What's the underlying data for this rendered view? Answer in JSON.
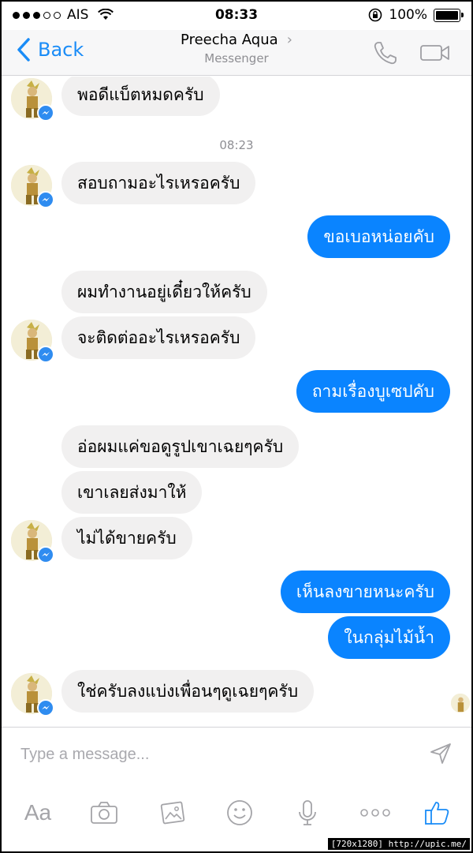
{
  "status_bar": {
    "carrier": "AIS",
    "time": "08:33",
    "battery": "100%",
    "signal_bars_filled": 3,
    "signal_bars_total": 5
  },
  "nav": {
    "back_label": "Back",
    "contact_name": "Preecha Aqua",
    "contact_subtitle": "Messenger"
  },
  "conversation": {
    "timestamp": "08:23",
    "messages": [
      {
        "side": "in",
        "text": "พอดีแบ็ตหมดครับ"
      },
      {
        "side": "in",
        "text": "สอบถามอะไรเหรอครับ"
      },
      {
        "side": "out",
        "text": "ขอเบอหน่อยคับ"
      },
      {
        "side": "in",
        "text": "ผมทำงานอยู่เดี๋ยวให้ครับ"
      },
      {
        "side": "in",
        "text": "จะติดต่ออะไรเหรอครับ"
      },
      {
        "side": "out",
        "text": "ถามเรื่องบูเซปคับ"
      },
      {
        "side": "in",
        "text": "อ่อผมแค่ขอดูรูปเขาเฉยๆครับ"
      },
      {
        "side": "in",
        "text": "เขาเลยส่งมาให้"
      },
      {
        "side": "in",
        "text": "ไม่ได้ขายครับ"
      },
      {
        "side": "out",
        "text": "เห็นลงขายหนะครับ"
      },
      {
        "side": "out",
        "text": "ในกลุ่มไม้น้ำ"
      },
      {
        "side": "in",
        "text": "ใช่ครับลงแบ่งเพื่อนๆดูเฉยๆครับ"
      }
    ]
  },
  "composer": {
    "placeholder": "Type a message...",
    "text_size_label": "Aa"
  },
  "footer_tag": "[720x1280] http://upic.me/",
  "colors": {
    "accent": "#0a84ff",
    "incoming_bubble": "#f1f0f0",
    "outgoing_bubble": "#0a84ff"
  }
}
